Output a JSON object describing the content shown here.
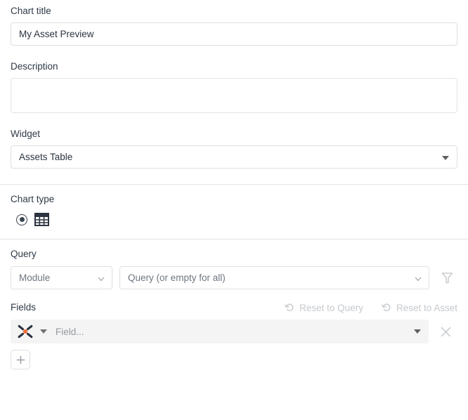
{
  "form": {
    "chart_title": {
      "label": "Chart title",
      "value": "My Asset Preview",
      "placeholder": ""
    },
    "description": {
      "label": "Description",
      "value": "",
      "placeholder": ""
    },
    "widget": {
      "label": "Widget",
      "value": "Assets Table",
      "caret_icon": "caret-down-icon"
    },
    "chart_type": {
      "label": "Chart type",
      "options": [
        {
          "id": "table",
          "icon": "table-grid-icon",
          "selected": true
        }
      ]
    },
    "query": {
      "label": "Query",
      "module_select": {
        "value": "Module",
        "is_placeholder": true,
        "caret_icon": "chevron-down-icon"
      },
      "query_select": {
        "value": "Query (or empty for all)",
        "is_placeholder": true,
        "caret_icon": "chevron-down-icon"
      },
      "filter_button": {
        "icon": "funnel-filter-icon",
        "enabled": false
      }
    },
    "fields": {
      "label": "Fields",
      "reset_to_query": {
        "label": "Reset to Query",
        "icon": "undo-arrow-icon",
        "enabled": false
      },
      "reset_to_asset": {
        "label": "Reset to Asset",
        "icon": "undo-arrow-icon",
        "enabled": false
      },
      "rows": [
        {
          "type_icon": "asset-cluster-icon",
          "placeholder": "Field...",
          "value": "",
          "remove_icon": "close-x-icon"
        }
      ],
      "add_button": {
        "label": "+",
        "icon": "plus-icon"
      }
    }
  },
  "colors": {
    "accent_orange": "#f2703a",
    "icon_dark": "#262f3d",
    "text": "#2b3440",
    "muted": "#93999f",
    "disabled": "#c5c9cd",
    "border": "#dedede",
    "field_bg": "#f4f4f4"
  }
}
